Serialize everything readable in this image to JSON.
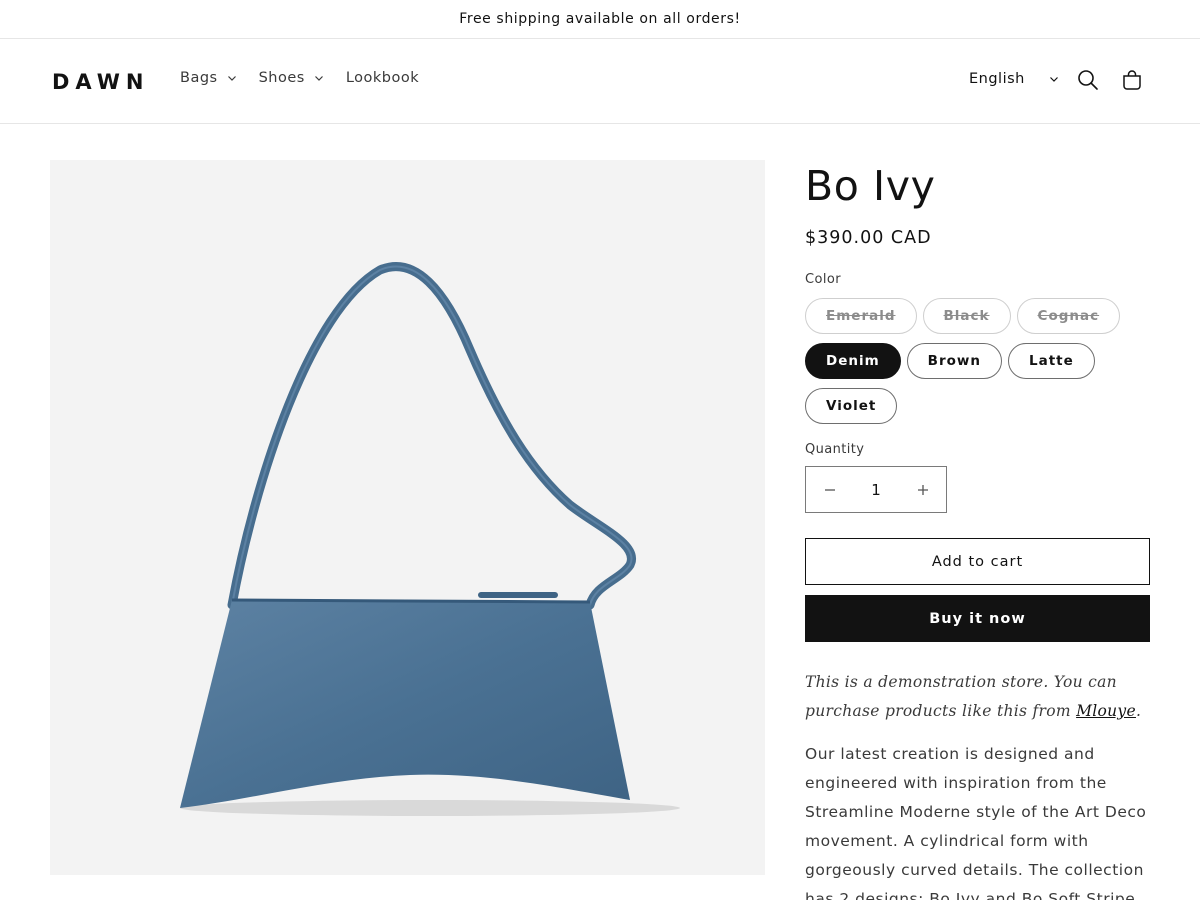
{
  "announcement": {
    "text": "Free shipping available on all orders!"
  },
  "header": {
    "logo": "DAWN",
    "nav": [
      {
        "label": "Bags",
        "has_dropdown": true
      },
      {
        "label": "Shoes",
        "has_dropdown": true
      },
      {
        "label": "Lookbook",
        "has_dropdown": false
      }
    ],
    "language": "English",
    "icons": [
      "search-icon",
      "cart-icon"
    ]
  },
  "product": {
    "title": "Bo Ivy",
    "price": "$390.00 CAD",
    "image_icon": "handbag-image",
    "color_label": "Color",
    "colors": [
      {
        "label": "Emerald",
        "state": "unavailable"
      },
      {
        "label": "Black",
        "state": "unavailable"
      },
      {
        "label": "Cognac",
        "state": "unavailable"
      },
      {
        "label": "Denim",
        "state": "selected"
      },
      {
        "label": "Brown",
        "state": "available"
      },
      {
        "label": "Latte",
        "state": "available"
      },
      {
        "label": "Violet",
        "state": "available"
      }
    ],
    "quantity_label": "Quantity",
    "quantity": "1",
    "add_to_cart": "Add to cart",
    "buy_now": "Buy it now",
    "demo_note_prefix": "This is a demonstration store. You can purchase products like this from ",
    "demo_note_link": "Mlouye",
    "demo_note_suffix": ".",
    "description": "Our latest creation is designed and engineered with inspiration from the Streamline Moderne style of the Art Deco movement. A cylindrical form with gorgeously curved details. The collection has 2 designs: Bo Ivy and Bo Soft Stripe."
  },
  "colors": {
    "text": "#121212",
    "border": "#e6e6e6",
    "media_bg": "#f3f3f3",
    "bag": "#4a7193"
  }
}
